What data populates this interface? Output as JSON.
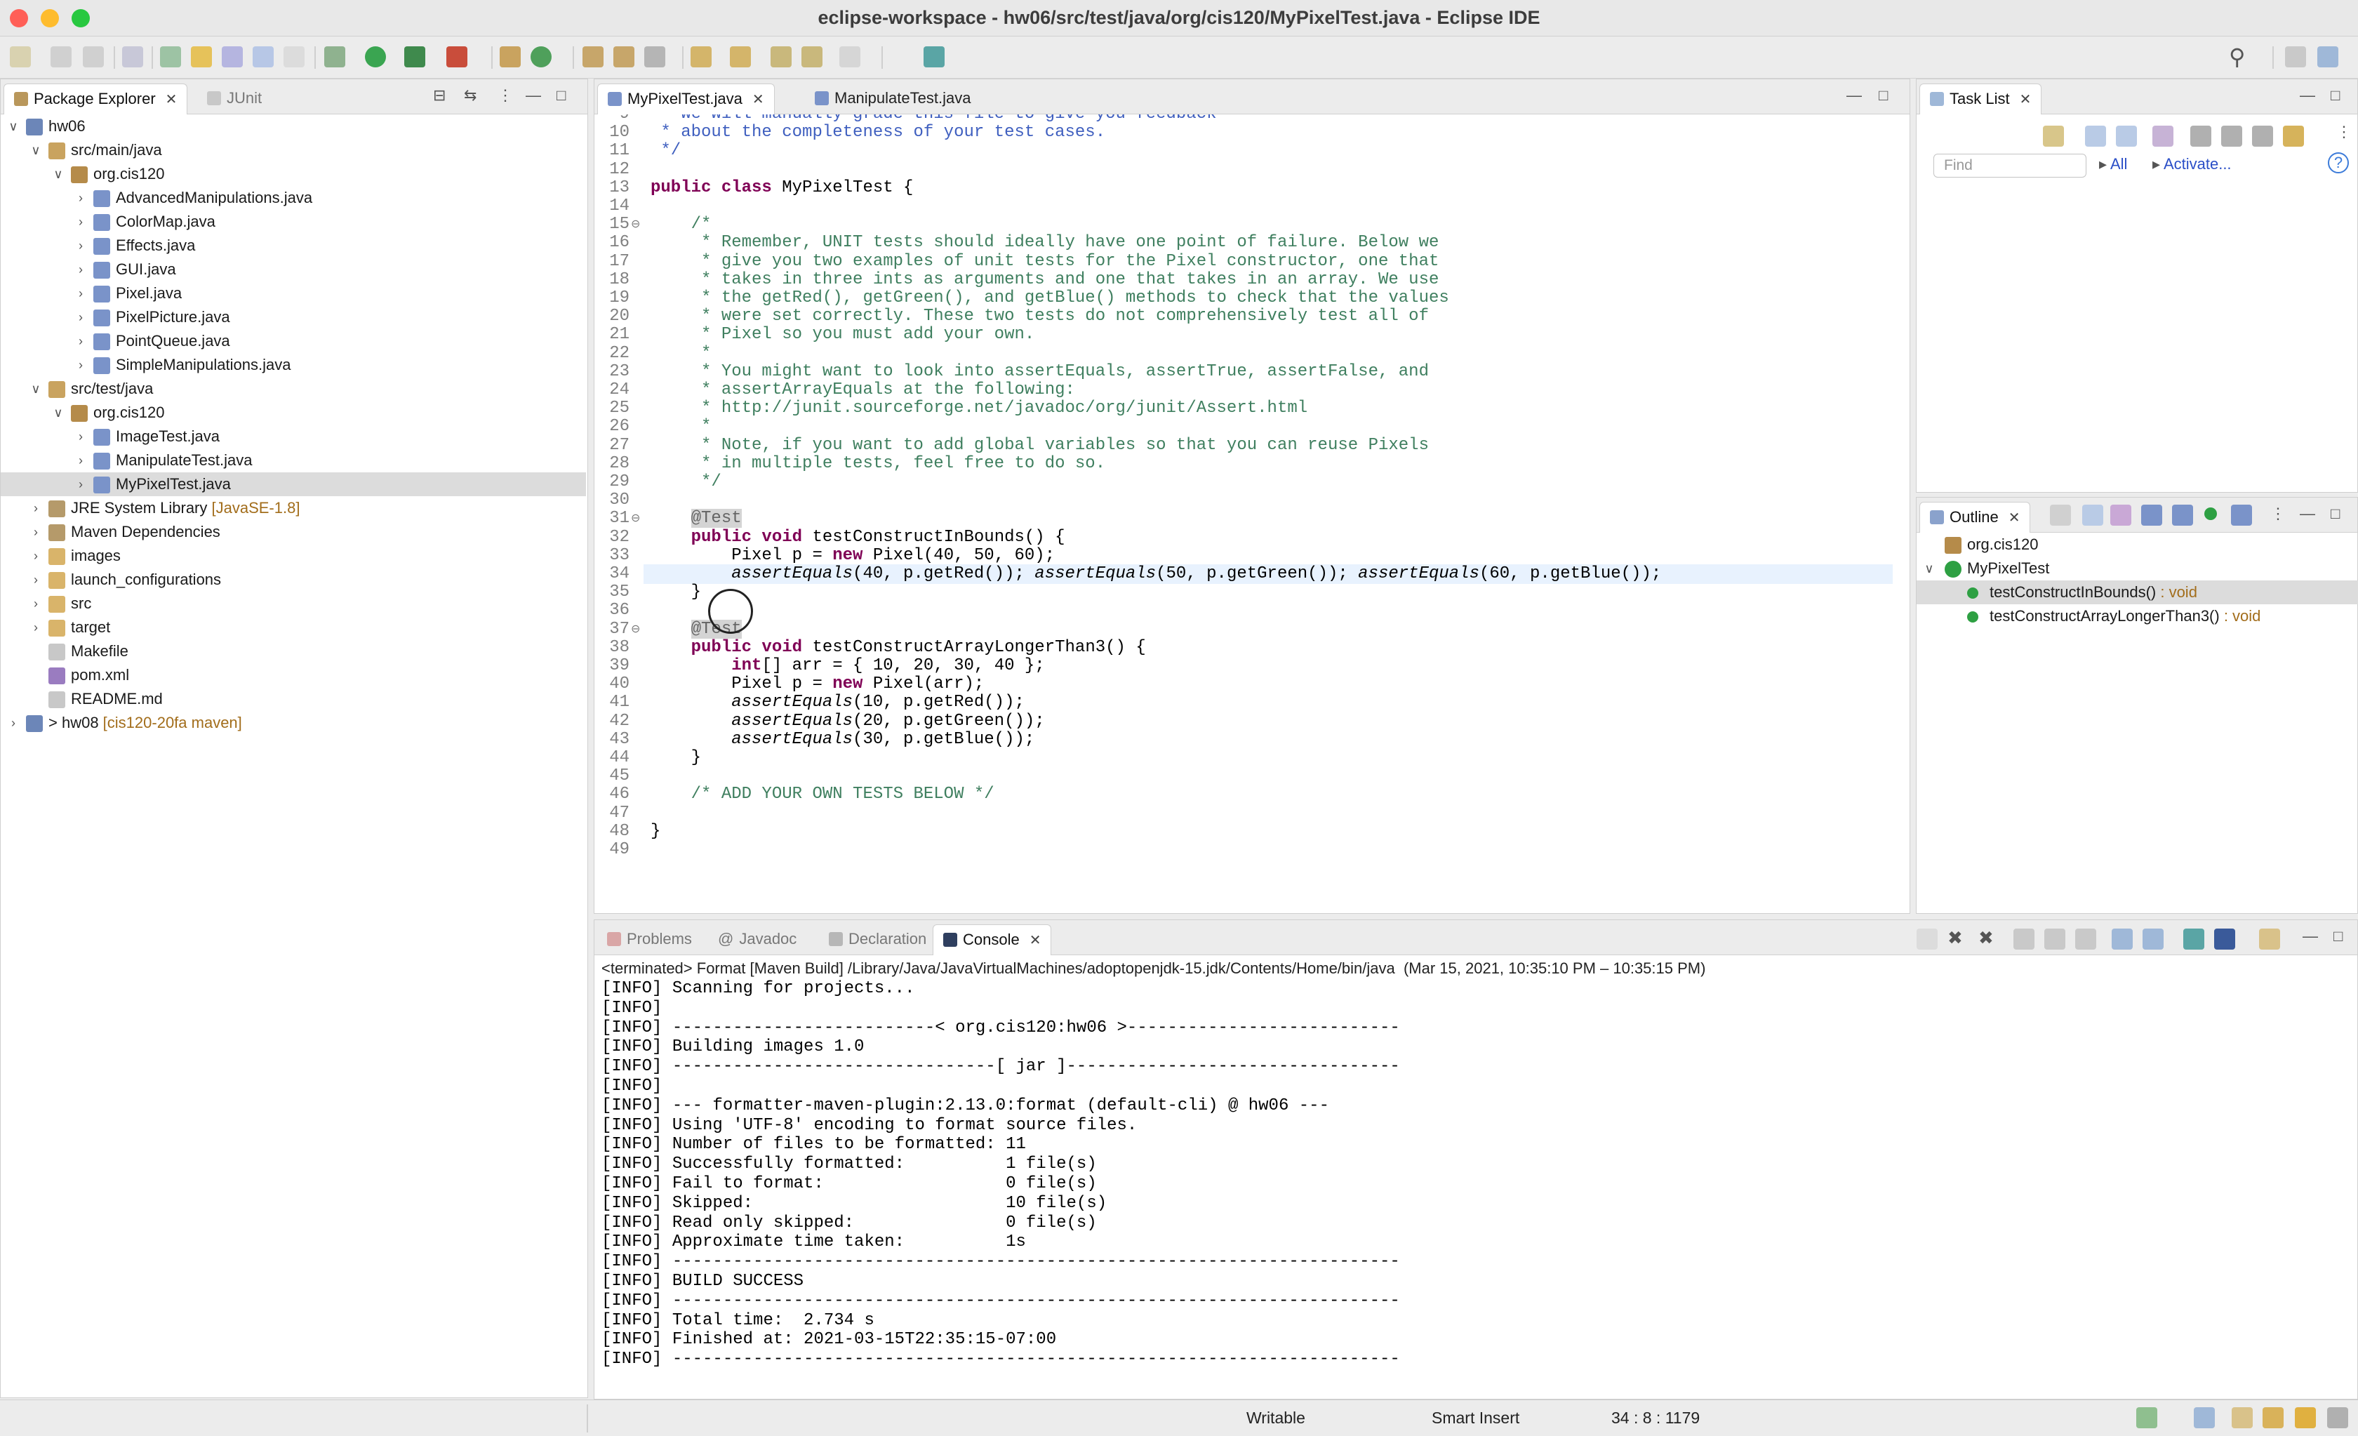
{
  "window": {
    "title": "eclipse-workspace - hw06/src/test/java/org/cis120/MyPixelTest.java - Eclipse IDE"
  },
  "left_panel": {
    "tabs": [
      {
        "label": "Package Explorer",
        "active": true
      },
      {
        "label": "JUnit",
        "active": false
      }
    ],
    "tree": [
      {
        "label": "hw06",
        "icon": "project-icon",
        "level": 0,
        "expanded": true
      },
      {
        "label": "src/main/java",
        "icon": "source-folder-icon",
        "level": 1,
        "expanded": true
      },
      {
        "label": "org.cis120",
        "icon": "package-icon",
        "level": 2,
        "expanded": true
      },
      {
        "label": "AdvancedManipulations.java",
        "icon": "java-file-icon",
        "level": 3,
        "expanded": false
      },
      {
        "label": "ColorMap.java",
        "icon": "java-file-icon",
        "level": 3,
        "expanded": false
      },
      {
        "label": "Effects.java",
        "icon": "java-file-icon",
        "level": 3,
        "expanded": false
      },
      {
        "label": "GUI.java",
        "icon": "java-file-icon",
        "level": 3,
        "expanded": false
      },
      {
        "label": "Pixel.java",
        "icon": "java-file-icon",
        "level": 3,
        "expanded": false
      },
      {
        "label": "PixelPicture.java",
        "icon": "java-file-icon",
        "level": 3,
        "expanded": false
      },
      {
        "label": "PointQueue.java",
        "icon": "java-file-icon",
        "level": 3,
        "expanded": false
      },
      {
        "label": "SimpleManipulations.java",
        "icon": "java-file-icon",
        "level": 3,
        "expanded": false
      },
      {
        "label": "src/test/java",
        "icon": "source-folder-icon",
        "level": 1,
        "expanded": true
      },
      {
        "label": "org.cis120",
        "icon": "package-icon",
        "level": 2,
        "expanded": true
      },
      {
        "label": "ImageTest.java",
        "icon": "java-file-icon",
        "level": 3,
        "expanded": false
      },
      {
        "label": "ManipulateTest.java",
        "icon": "java-file-icon",
        "level": 3,
        "expanded": false
      },
      {
        "label": "MyPixelTest.java",
        "icon": "java-file-icon",
        "level": 3,
        "expanded": false,
        "selected": true
      },
      {
        "label": "JRE System Library",
        "decoration": "[JavaSE-1.8]",
        "icon": "library-icon",
        "level": 1,
        "expanded": false
      },
      {
        "label": "Maven Dependencies",
        "icon": "library-icon",
        "level": 1,
        "expanded": false
      },
      {
        "label": "images",
        "icon": "folder-icon",
        "level": 1,
        "expanded": false
      },
      {
        "label": "launch_configurations",
        "icon": "folder-icon",
        "level": 1,
        "expanded": false
      },
      {
        "label": "src",
        "icon": "folder-icon",
        "level": 1,
        "expanded": false
      },
      {
        "label": "target",
        "icon": "folder-icon",
        "level": 1,
        "expanded": false
      },
      {
        "label": "Makefile",
        "icon": "file-icon",
        "level": 1,
        "leaf": true
      },
      {
        "label": "pom.xml",
        "icon": "xml-file-icon",
        "level": 1,
        "leaf": true
      },
      {
        "label": "README.md",
        "icon": "file-icon",
        "level": 1,
        "leaf": true
      },
      {
        "label": "> hw08",
        "decoration": "[cis120-20fa maven]",
        "icon": "project-icon",
        "level": 0,
        "expanded": false
      }
    ]
  },
  "editor": {
    "tabs": [
      {
        "label": "MyPixelTest.java",
        "active": true
      },
      {
        "label": "ManipulateTest.java",
        "active": false
      }
    ],
    "cursor_line": 34,
    "lines": [
      {
        "n": "9",
        "parts": [
          {
            "t": " * we will manually grade this file to give you feedback",
            "c": "jd"
          }
        ]
      },
      {
        "n": "10",
        "parts": [
          {
            "t": " * about the completeness of your test cases.",
            "c": "jd"
          }
        ]
      },
      {
        "n": "11",
        "parts": [
          {
            "t": " */",
            "c": "jd"
          }
        ]
      },
      {
        "n": "12",
        "parts": []
      },
      {
        "n": "13",
        "parts": [
          {
            "t": "public class",
            "c": "kw"
          },
          {
            "t": " MyPixelTest {",
            "c": ""
          }
        ]
      },
      {
        "n": "14",
        "parts": []
      },
      {
        "n": "15",
        "fold": true,
        "parts": [
          {
            "t": "    /*",
            "c": "cm"
          }
        ]
      },
      {
        "n": "16",
        "parts": [
          {
            "t": "     * Remember, UNIT tests should ideally have one point of failure. Below we",
            "c": "cm"
          }
        ]
      },
      {
        "n": "17",
        "parts": [
          {
            "t": "     * give you two examples of unit tests for the Pixel constructor, one that",
            "c": "cm"
          }
        ]
      },
      {
        "n": "18",
        "parts": [
          {
            "t": "     * takes in three ints as arguments and one that takes in an array. We use",
            "c": "cm"
          }
        ]
      },
      {
        "n": "19",
        "parts": [
          {
            "t": "     * the getRed(), getGreen(), and getBlue() methods to check that the values",
            "c": "cm"
          }
        ]
      },
      {
        "n": "20",
        "parts": [
          {
            "t": "     * were set correctly. These two tests do not comprehensively test all of",
            "c": "cm"
          }
        ]
      },
      {
        "n": "21",
        "parts": [
          {
            "t": "     * Pixel so you must add your own.",
            "c": "cm"
          }
        ]
      },
      {
        "n": "22",
        "parts": [
          {
            "t": "     *",
            "c": "cm"
          }
        ]
      },
      {
        "n": "23",
        "parts": [
          {
            "t": "     * You might want to look into assertEquals, assertTrue, assertFalse, and",
            "c": "cm"
          }
        ]
      },
      {
        "n": "24",
        "parts": [
          {
            "t": "     * assertArrayEquals at the following:",
            "c": "cm"
          }
        ]
      },
      {
        "n": "25",
        "parts": [
          {
            "t": "     * http://junit.sourceforge.net/javadoc/org/junit/Assert.html",
            "c": "cm"
          }
        ]
      },
      {
        "n": "26",
        "parts": [
          {
            "t": "     *",
            "c": "cm"
          }
        ]
      },
      {
        "n": "27",
        "parts": [
          {
            "t": "     * Note, if you want to add global variables so that you can reuse Pixels",
            "c": "cm"
          }
        ]
      },
      {
        "n": "28",
        "parts": [
          {
            "t": "     * in multiple tests, feel free to do so.",
            "c": "cm"
          }
        ]
      },
      {
        "n": "29",
        "parts": [
          {
            "t": "     */",
            "c": "cm"
          }
        ]
      },
      {
        "n": "30",
        "parts": []
      },
      {
        "n": "31",
        "fold": true,
        "parts": [
          {
            "t": "    ",
            "c": ""
          },
          {
            "t": "@Test",
            "c": "ann"
          }
        ]
      },
      {
        "n": "32",
        "parts": [
          {
            "t": "    ",
            "c": ""
          },
          {
            "t": "public void",
            "c": "kw"
          },
          {
            "t": " testConstructInBounds() {",
            "c": ""
          }
        ]
      },
      {
        "n": "33",
        "parts": [
          {
            "t": "        Pixel p = ",
            "c": ""
          },
          {
            "t": "new",
            "c": "kw"
          },
          {
            "t": " Pixel(40, 50, 60);",
            "c": ""
          }
        ]
      },
      {
        "n": "34",
        "parts": [
          {
            "t": "        ",
            "c": ""
          },
          {
            "t": "assertEquals",
            "c": "it"
          },
          {
            "t": "(40, p.getRed()); ",
            "c": ""
          },
          {
            "t": "assertEquals",
            "c": "it"
          },
          {
            "t": "(50, p.getGreen()); ",
            "c": ""
          },
          {
            "t": "assertEquals",
            "c": "it"
          },
          {
            "t": "(60, p.getBlue());",
            "c": ""
          }
        ]
      },
      {
        "n": "35",
        "parts": [
          {
            "t": "    }",
            "c": ""
          }
        ]
      },
      {
        "n": "36",
        "parts": []
      },
      {
        "n": "37",
        "fold": true,
        "parts": [
          {
            "t": "    ",
            "c": ""
          },
          {
            "t": "@Test",
            "c": "ann"
          }
        ]
      },
      {
        "n": "38",
        "parts": [
          {
            "t": "    ",
            "c": ""
          },
          {
            "t": "public void",
            "c": "kw"
          },
          {
            "t": " testConstructArrayLongerThan3() {",
            "c": ""
          }
        ]
      },
      {
        "n": "39",
        "parts": [
          {
            "t": "        ",
            "c": ""
          },
          {
            "t": "int",
            "c": "kw"
          },
          {
            "t": "[] arr = { 10, 20, 30, 40 };",
            "c": ""
          }
        ]
      },
      {
        "n": "40",
        "parts": [
          {
            "t": "        Pixel p = ",
            "c": ""
          },
          {
            "t": "new",
            "c": "kw"
          },
          {
            "t": " Pixel(arr);",
            "c": ""
          }
        ]
      },
      {
        "n": "41",
        "parts": [
          {
            "t": "        ",
            "c": ""
          },
          {
            "t": "assertEquals",
            "c": "it"
          },
          {
            "t": "(10, p.getRed());",
            "c": ""
          }
        ]
      },
      {
        "n": "42",
        "parts": [
          {
            "t": "        ",
            "c": ""
          },
          {
            "t": "assertEquals",
            "c": "it"
          },
          {
            "t": "(20, p.getGreen());",
            "c": ""
          }
        ]
      },
      {
        "n": "43",
        "parts": [
          {
            "t": "        ",
            "c": ""
          },
          {
            "t": "assertEquals",
            "c": "it"
          },
          {
            "t": "(30, p.getBlue());",
            "c": ""
          }
        ]
      },
      {
        "n": "44",
        "parts": [
          {
            "t": "    }",
            "c": ""
          }
        ]
      },
      {
        "n": "45",
        "parts": []
      },
      {
        "n": "46",
        "parts": [
          {
            "t": "    /* ADD YOUR OWN TESTS BELOW */",
            "c": "cm"
          }
        ]
      },
      {
        "n": "47",
        "parts": []
      },
      {
        "n": "48",
        "parts": [
          {
            "t": "}",
            "c": ""
          }
        ]
      },
      {
        "n": "49",
        "parts": []
      }
    ]
  },
  "task_list": {
    "tab_label": "Task List",
    "find_placeholder": "Find",
    "all_label": "All",
    "activate_label": "Activate..."
  },
  "outline": {
    "tab_label": "Outline",
    "items": [
      {
        "label": "org.cis120",
        "icon": "package-icon",
        "level": 0
      },
      {
        "label": "MyPixelTest",
        "icon": "class-icon",
        "level": 0,
        "expanded": true
      },
      {
        "label": "testConstructInBounds()",
        "type": " : void",
        "icon": "method-icon",
        "level": 1,
        "selected": true
      },
      {
        "label": "testConstructArrayLongerThan3()",
        "type": " : void",
        "icon": "method-icon",
        "level": 1
      }
    ]
  },
  "bottom_panel": {
    "tabs": [
      {
        "label": "Problems",
        "active": false
      },
      {
        "label": "Javadoc",
        "active": false
      },
      {
        "label": "Declaration",
        "active": false
      },
      {
        "label": "Console",
        "active": true
      }
    ],
    "header": "<terminated> Format [Maven Build] /Library/Java/JavaVirtualMachines/adoptopenjdk-15.jdk/Contents/Home/bin/java  (Mar 15, 2021, 10:35:10 PM – 10:35:15 PM)",
    "lines": [
      "[INFO] Scanning for projects...",
      "[INFO]",
      "[INFO] --------------------------< org.cis120:hw06 >---------------------------",
      "[INFO] Building images 1.0",
      "[INFO] --------------------------------[ jar ]---------------------------------",
      "[INFO]",
      "[INFO] --- formatter-maven-plugin:2.13.0:format (default-cli) @ hw06 ---",
      "[INFO] Using 'UTF-8' encoding to format source files.",
      "[INFO] Number of files to be formatted: 11",
      "[INFO] Successfully formatted:          1 file(s)",
      "[INFO] Fail to format:                  0 file(s)",
      "[INFO] Skipped:                         10 file(s)",
      "[INFO] Read only skipped:               0 file(s)",
      "[INFO] Approximate time taken:          1s",
      "[INFO] ------------------------------------------------------------------------",
      "[INFO] BUILD SUCCESS",
      "[INFO] ------------------------------------------------------------------------",
      "[INFO] Total time:  2.734 s",
      "[INFO] Finished at: 2021-03-15T22:35:15-07:00",
      "[INFO] ------------------------------------------------------------------------"
    ]
  },
  "status": {
    "writable": "Writable",
    "insert_mode": "Smart Insert",
    "position": "34 : 8 : 1179"
  },
  "colors": {
    "keyword": "#7f0055",
    "comment": "#3f7f5f",
    "javadoc": "#3f5fbf",
    "selection": "#dcdcdc",
    "current_line": "#e8f2fe",
    "link": "#2a4ec7"
  }
}
